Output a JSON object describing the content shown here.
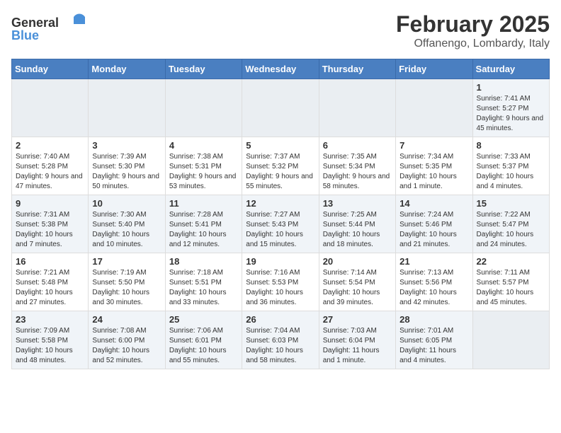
{
  "header": {
    "logo_general": "General",
    "logo_blue": "Blue",
    "month_title": "February 2025",
    "location": "Offanengo, Lombardy, Italy"
  },
  "weekdays": [
    "Sunday",
    "Monday",
    "Tuesday",
    "Wednesday",
    "Thursday",
    "Friday",
    "Saturday"
  ],
  "weeks": [
    [
      {
        "day": "",
        "info": ""
      },
      {
        "day": "",
        "info": ""
      },
      {
        "day": "",
        "info": ""
      },
      {
        "day": "",
        "info": ""
      },
      {
        "day": "",
        "info": ""
      },
      {
        "day": "",
        "info": ""
      },
      {
        "day": "1",
        "info": "Sunrise: 7:41 AM\nSunset: 5:27 PM\nDaylight: 9 hours and 45 minutes."
      }
    ],
    [
      {
        "day": "2",
        "info": "Sunrise: 7:40 AM\nSunset: 5:28 PM\nDaylight: 9 hours and 47 minutes."
      },
      {
        "day": "3",
        "info": "Sunrise: 7:39 AM\nSunset: 5:30 PM\nDaylight: 9 hours and 50 minutes."
      },
      {
        "day": "4",
        "info": "Sunrise: 7:38 AM\nSunset: 5:31 PM\nDaylight: 9 hours and 53 minutes."
      },
      {
        "day": "5",
        "info": "Sunrise: 7:37 AM\nSunset: 5:32 PM\nDaylight: 9 hours and 55 minutes."
      },
      {
        "day": "6",
        "info": "Sunrise: 7:35 AM\nSunset: 5:34 PM\nDaylight: 9 hours and 58 minutes."
      },
      {
        "day": "7",
        "info": "Sunrise: 7:34 AM\nSunset: 5:35 PM\nDaylight: 10 hours and 1 minute."
      },
      {
        "day": "8",
        "info": "Sunrise: 7:33 AM\nSunset: 5:37 PM\nDaylight: 10 hours and 4 minutes."
      }
    ],
    [
      {
        "day": "9",
        "info": "Sunrise: 7:31 AM\nSunset: 5:38 PM\nDaylight: 10 hours and 7 minutes."
      },
      {
        "day": "10",
        "info": "Sunrise: 7:30 AM\nSunset: 5:40 PM\nDaylight: 10 hours and 10 minutes."
      },
      {
        "day": "11",
        "info": "Sunrise: 7:28 AM\nSunset: 5:41 PM\nDaylight: 10 hours and 12 minutes."
      },
      {
        "day": "12",
        "info": "Sunrise: 7:27 AM\nSunset: 5:43 PM\nDaylight: 10 hours and 15 minutes."
      },
      {
        "day": "13",
        "info": "Sunrise: 7:25 AM\nSunset: 5:44 PM\nDaylight: 10 hours and 18 minutes."
      },
      {
        "day": "14",
        "info": "Sunrise: 7:24 AM\nSunset: 5:46 PM\nDaylight: 10 hours and 21 minutes."
      },
      {
        "day": "15",
        "info": "Sunrise: 7:22 AM\nSunset: 5:47 PM\nDaylight: 10 hours and 24 minutes."
      }
    ],
    [
      {
        "day": "16",
        "info": "Sunrise: 7:21 AM\nSunset: 5:48 PM\nDaylight: 10 hours and 27 minutes."
      },
      {
        "day": "17",
        "info": "Sunrise: 7:19 AM\nSunset: 5:50 PM\nDaylight: 10 hours and 30 minutes."
      },
      {
        "day": "18",
        "info": "Sunrise: 7:18 AM\nSunset: 5:51 PM\nDaylight: 10 hours and 33 minutes."
      },
      {
        "day": "19",
        "info": "Sunrise: 7:16 AM\nSunset: 5:53 PM\nDaylight: 10 hours and 36 minutes."
      },
      {
        "day": "20",
        "info": "Sunrise: 7:14 AM\nSunset: 5:54 PM\nDaylight: 10 hours and 39 minutes."
      },
      {
        "day": "21",
        "info": "Sunrise: 7:13 AM\nSunset: 5:56 PM\nDaylight: 10 hours and 42 minutes."
      },
      {
        "day": "22",
        "info": "Sunrise: 7:11 AM\nSunset: 5:57 PM\nDaylight: 10 hours and 45 minutes."
      }
    ],
    [
      {
        "day": "23",
        "info": "Sunrise: 7:09 AM\nSunset: 5:58 PM\nDaylight: 10 hours and 48 minutes."
      },
      {
        "day": "24",
        "info": "Sunrise: 7:08 AM\nSunset: 6:00 PM\nDaylight: 10 hours and 52 minutes."
      },
      {
        "day": "25",
        "info": "Sunrise: 7:06 AM\nSunset: 6:01 PM\nDaylight: 10 hours and 55 minutes."
      },
      {
        "day": "26",
        "info": "Sunrise: 7:04 AM\nSunset: 6:03 PM\nDaylight: 10 hours and 58 minutes."
      },
      {
        "day": "27",
        "info": "Sunrise: 7:03 AM\nSunset: 6:04 PM\nDaylight: 11 hours and 1 minute."
      },
      {
        "day": "28",
        "info": "Sunrise: 7:01 AM\nSunset: 6:05 PM\nDaylight: 11 hours and 4 minutes."
      },
      {
        "day": "",
        "info": ""
      }
    ]
  ]
}
